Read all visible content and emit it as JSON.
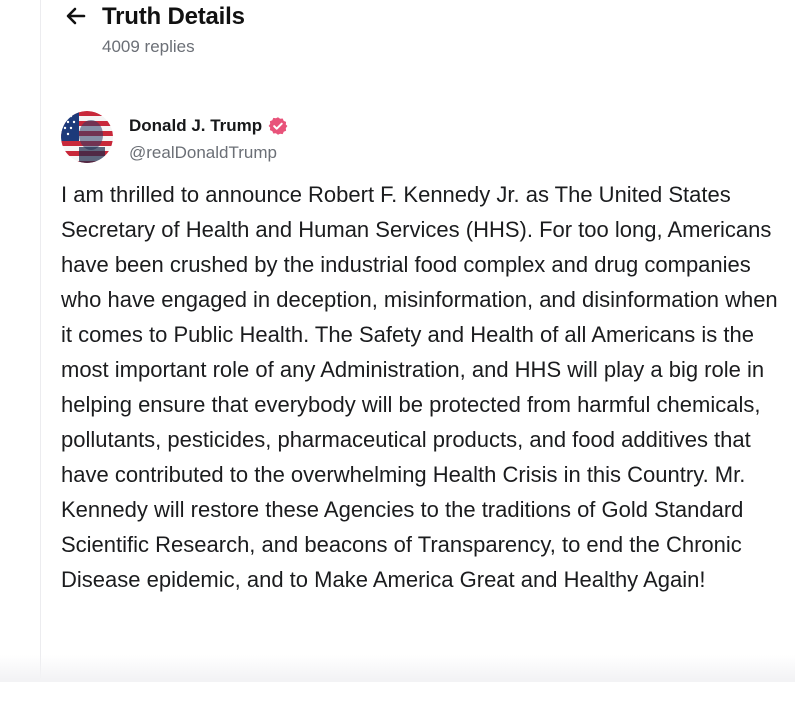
{
  "header": {
    "title": "Truth Details",
    "replies": "4009 replies",
    "back_icon": "arrow-left-icon"
  },
  "post": {
    "author": {
      "name": "Donald J. Trump",
      "handle": "@realDonaldTrump",
      "verified_icon": "verified-badge-icon",
      "verified_color": "#e8537a"
    },
    "body": "I am thrilled to announce Robert F. Kennedy Jr. as The United States Secretary of Health and Human Services (HHS). For too long, Americans have been crushed by the industrial food complex and drug companies who have engaged in deception, misinformation, and disinformation when it comes to Public Health. The Safety and Health of all Americans is the most important role of any Administration, and HHS will play a big role in helping ensure that everybody will be protected from harmful chemicals, pollutants, pesticides, pharmaceutical products, and food additives that have contributed to the overwhelming Health Crisis in this Country. Mr. Kennedy will restore these Agencies to the traditions of Gold Standard Scientific Research, and beacons of Transparency, to end the Chronic Disease epidemic, and to Make America Great and Healthy Again!"
  }
}
